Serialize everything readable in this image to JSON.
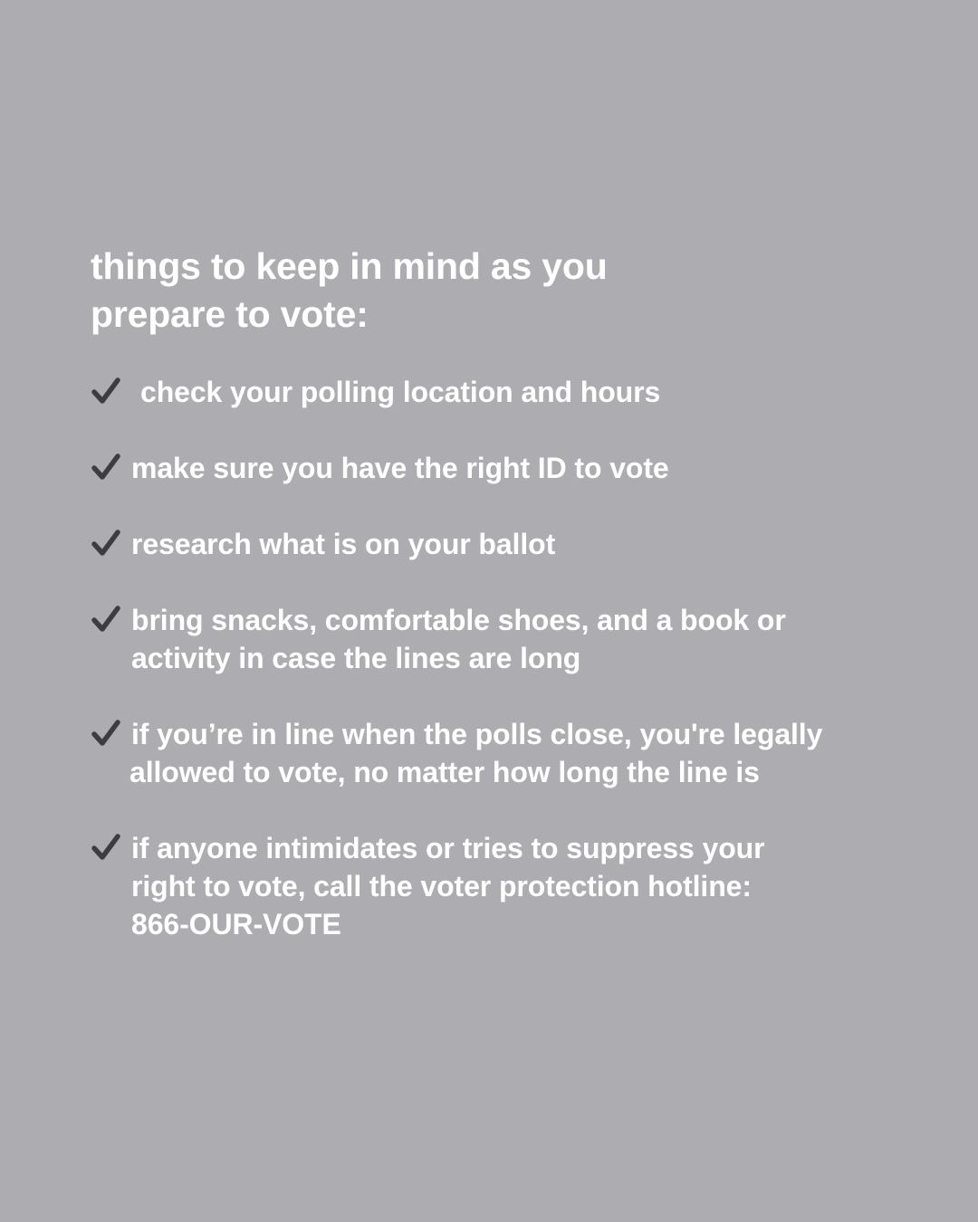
{
  "heading": {
    "line1": "things to keep in mind as you",
    "line2": "prepare to vote:"
  },
  "checklist": [
    {
      "icon": "check-icon",
      "lines": [
        "check your polling location and hours"
      ]
    },
    {
      "icon": "check-icon",
      "lines": [
        "make sure you have the right ID to vote"
      ]
    },
    {
      "icon": "check-icon",
      "lines": [
        "research what is on your ballot"
      ]
    },
    {
      "icon": "check-icon",
      "lines": [
        "bring snacks, comfortable shoes, and a book or",
        "activity in case the lines are long"
      ]
    },
    {
      "icon": "check-icon",
      "lines": [
        "if you’re in line when the polls close, you're legally",
        "allowed to vote, no matter how long the line is"
      ]
    },
    {
      "icon": "check-icon",
      "lines": [
        "if anyone intimidates or tries to suppress your",
        "right to vote, call the voter protection hotline:",
        "866-OUR-VOTE"
      ]
    }
  ],
  "colors": {
    "background": "#adadb1",
    "text": "#ffffff",
    "check": "#3d3d3f"
  }
}
